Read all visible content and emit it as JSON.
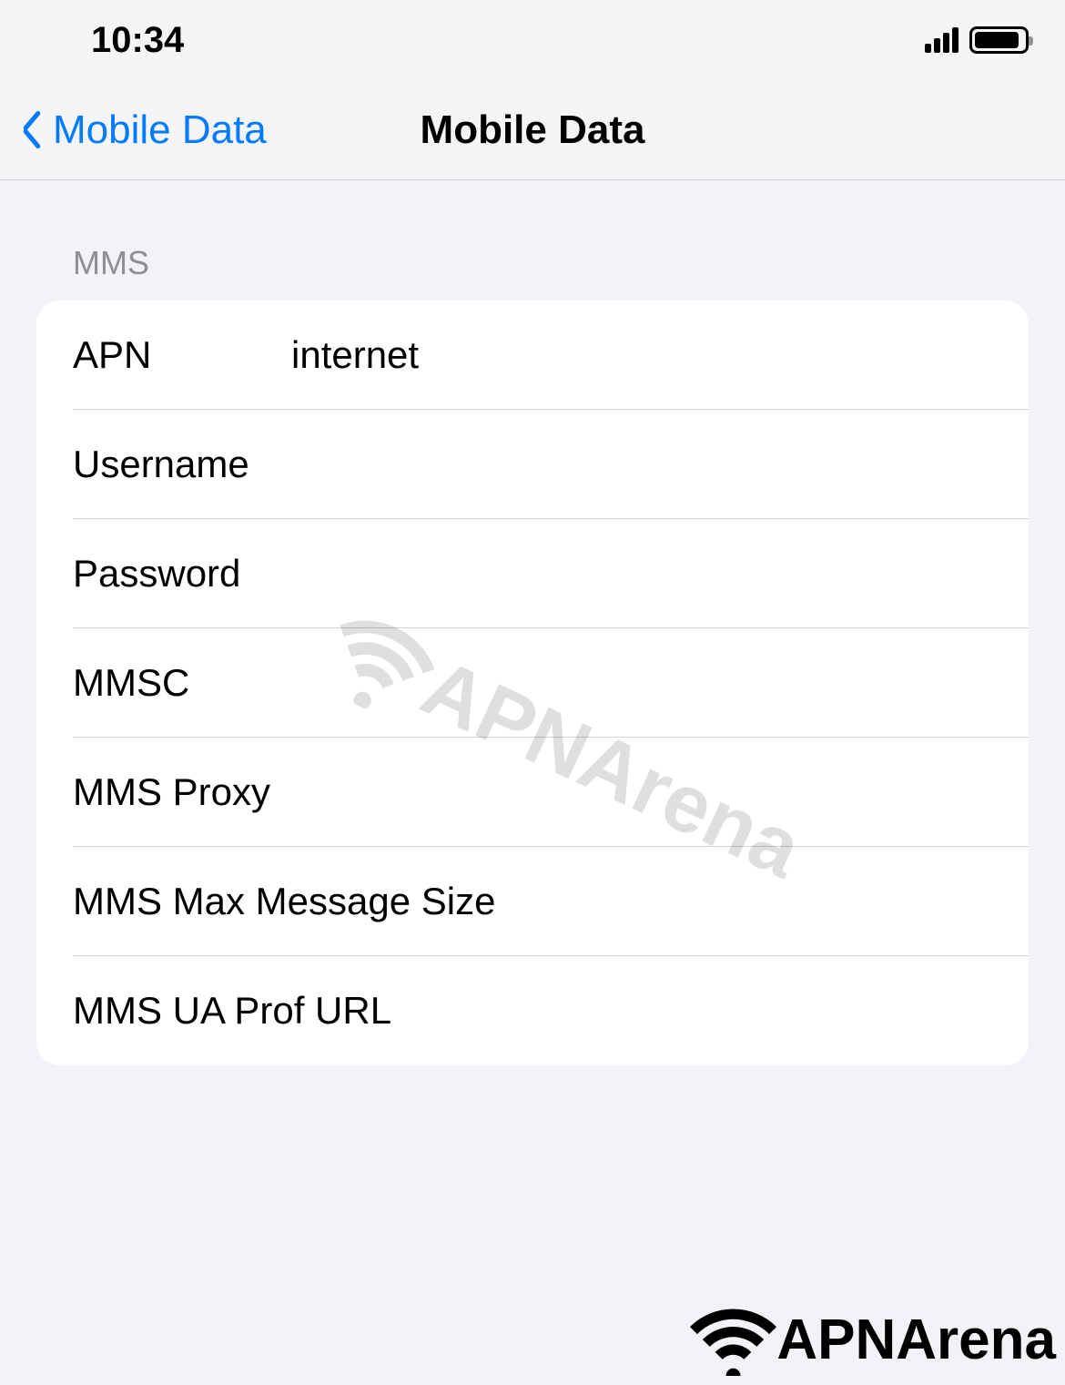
{
  "status_bar": {
    "time": "10:34"
  },
  "nav": {
    "back_label": "Mobile Data",
    "title": "Mobile Data"
  },
  "section": {
    "header": "MMS",
    "rows": [
      {
        "label": "APN",
        "value": "internet"
      },
      {
        "label": "Username",
        "value": ""
      },
      {
        "label": "Password",
        "value": ""
      },
      {
        "label": "MMSC",
        "value": ""
      },
      {
        "label": "MMS Proxy",
        "value": ""
      },
      {
        "label": "MMS Max Message Size",
        "value": ""
      },
      {
        "label": "MMS UA Prof URL",
        "value": ""
      }
    ]
  },
  "branding": {
    "watermark": "APNArena",
    "footer": "APNArena"
  }
}
